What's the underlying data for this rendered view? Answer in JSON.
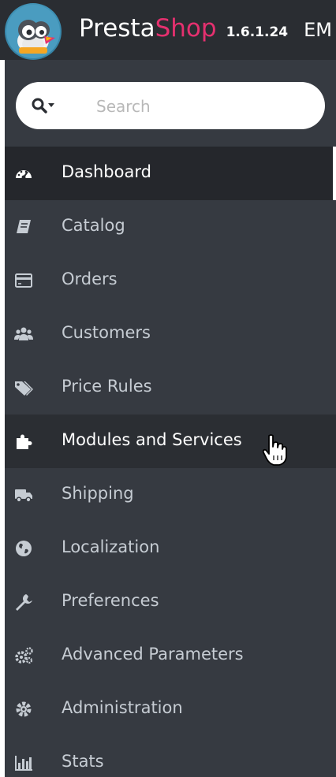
{
  "header": {
    "brand_part1": "Presta",
    "brand_part2": "Shop",
    "version": "1.6.1.24",
    "extra": "EM"
  },
  "search": {
    "placeholder": "Search"
  },
  "menu": [
    {
      "label": "Dashboard",
      "icon": "dashboard-icon",
      "state": "active"
    },
    {
      "label": "Catalog",
      "icon": "book-icon"
    },
    {
      "label": "Orders",
      "icon": "credit-card-icon"
    },
    {
      "label": "Customers",
      "icon": "users-icon"
    },
    {
      "label": "Price Rules",
      "icon": "tags-icon"
    },
    {
      "label": "Modules and Services",
      "icon": "puzzle-icon",
      "state": "hover"
    },
    {
      "label": "Shipping",
      "icon": "truck-icon"
    },
    {
      "label": "Localization",
      "icon": "globe-icon"
    },
    {
      "label": "Preferences",
      "icon": "wrench-icon"
    },
    {
      "label": "Advanced Parameters",
      "icon": "cogs-icon"
    },
    {
      "label": "Administration",
      "icon": "gear-icon"
    },
    {
      "label": "Stats",
      "icon": "bar-chart-icon"
    }
  ],
  "colors": {
    "header_bg": "#2a2d32",
    "sidebar_bg": "#363a41",
    "active_bg": "#25272c",
    "brand_accent": "#e5306f",
    "item_text": "#c6ccd3"
  }
}
